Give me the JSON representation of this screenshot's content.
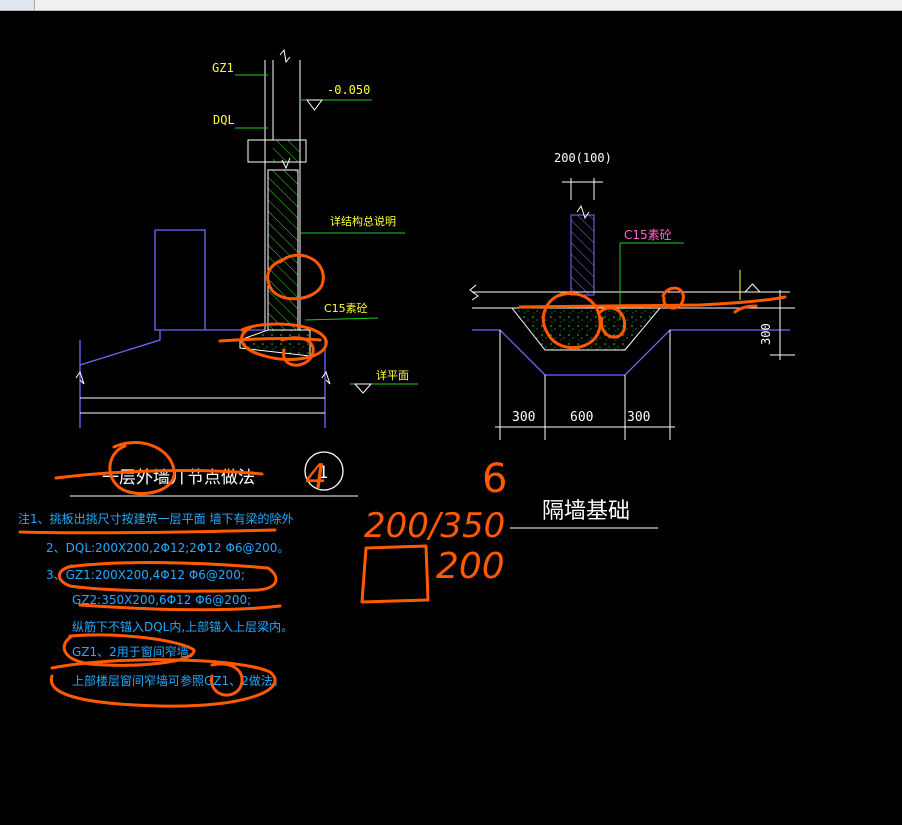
{
  "labels": {
    "gz1": "GZ1",
    "dql": "DQL",
    "elev": "-0.050",
    "col_note": "详结构总说明",
    "c15_left": "C15素砼",
    "ground": "详平面",
    "width_top": "200(100)",
    "c15_right": "C15素砼",
    "dim_right": "300",
    "dim_300a": "300",
    "dim_600": "600",
    "dim_300b": "300",
    "title_left": "一层外墙丌节点做法",
    "title_num": "1",
    "title_right": "隔墙基础"
  },
  "notes": [
    "注1、挑板出挑尺寸按建筑一层平面 墙下有梁的除外",
    "2、DQL:200X200,2Φ12;2Φ12 Φ6@200。",
    "3、GZ1:200X200,4Φ12 Φ6@200;",
    "GZ2:350X200,6Φ12 Φ6@200;",
    "纵筋下不锚入DQL内,上部锚入上层梁内。",
    "GZ1、2用于窗间窄墙。",
    "上部楼层窗间窄墙可参照GZ1、2做法。"
  ],
  "handwriting": {
    "n4": "4",
    "n6": "6",
    "ratio": "200/350",
    "n200": "200"
  },
  "colors": {
    "background": "#000000",
    "outline": "#6a6aff",
    "dimension": "#ffffff",
    "leader": "#22cc22",
    "label_yellow": "#ffff33",
    "hatch_green": "#22dd22",
    "note_cyan": "#22aaff",
    "markup_orange": "#ff5a00",
    "label_magenta": "#ff66cc"
  }
}
